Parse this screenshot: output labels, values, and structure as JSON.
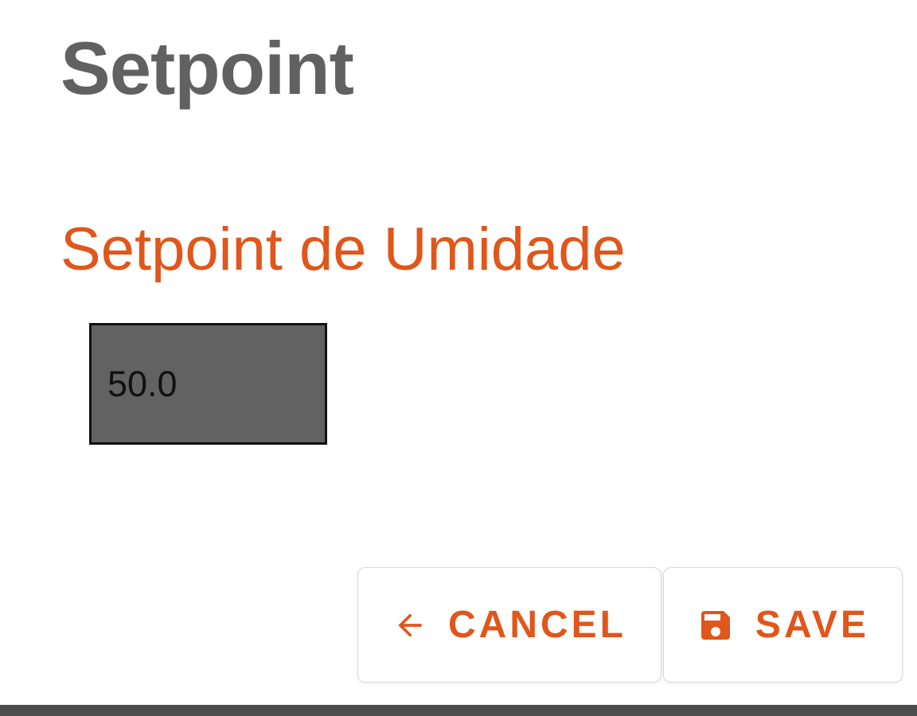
{
  "dialog": {
    "title": "Setpoint",
    "field_label": "Setpoint de Umidade",
    "input_value": "50.0"
  },
  "buttons": {
    "cancel": {
      "label": "CANCEL",
      "icon": "arrow-left-icon"
    },
    "save": {
      "label": "SAVE",
      "icon": "floppy-disk-icon"
    }
  },
  "colors": {
    "accent": "#e0561b",
    "title": "#616161",
    "input_background": "#626262"
  }
}
